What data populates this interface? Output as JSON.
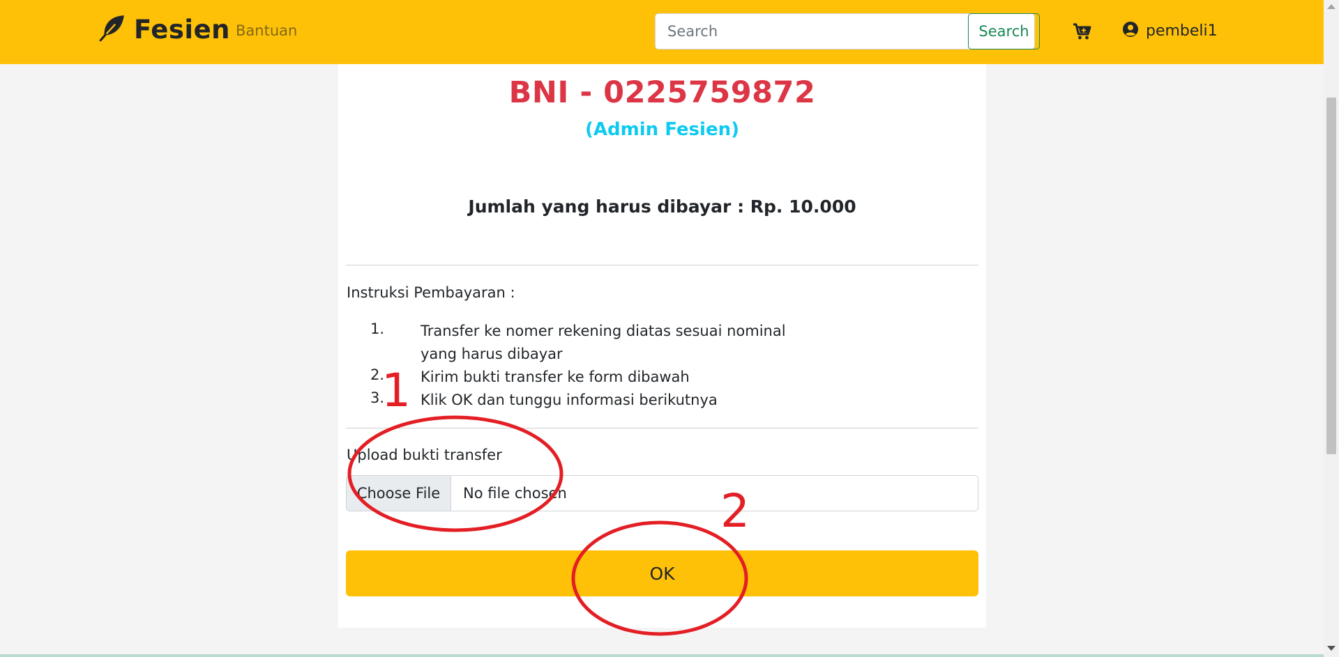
{
  "navbar": {
    "brand_name": "Fesien",
    "brand_icon": "feather-icon",
    "nav_link": "Bantuan",
    "search_placeholder": "Search",
    "search_button": "Search",
    "cart_icon": "cart-icon",
    "user_icon": "user-circle-icon",
    "username": "pembeli1",
    "color": "#ffc107"
  },
  "payment": {
    "bank_account": "BNI - 0225759872",
    "account_owner": "(Admin Fesien)",
    "amount_text": "Jumlah yang harus dibayar : Rp. 10.000",
    "instructions_title": "Instruksi Pembayaran :",
    "steps": [
      {
        "num": "1.",
        "text": "Transfer ke nomer rekening diatas sesuai nominal yang harus dibayar"
      },
      {
        "num": "2.",
        "text": "Kirim bukti transfer ke form dibawah"
      },
      {
        "num": "3.",
        "text": "Klik OK dan tunggu informasi berikutnya"
      }
    ],
    "upload_label": "Upload bukti transfer",
    "file_button": "Choose File",
    "file_status": "No file chosen",
    "ok_button": "OK",
    "bank_color": "#dc3545",
    "owner_color": "#0dcaf0"
  },
  "annotations": {
    "marker_1": "1",
    "marker_2": "2",
    "color": "#e31e24"
  }
}
